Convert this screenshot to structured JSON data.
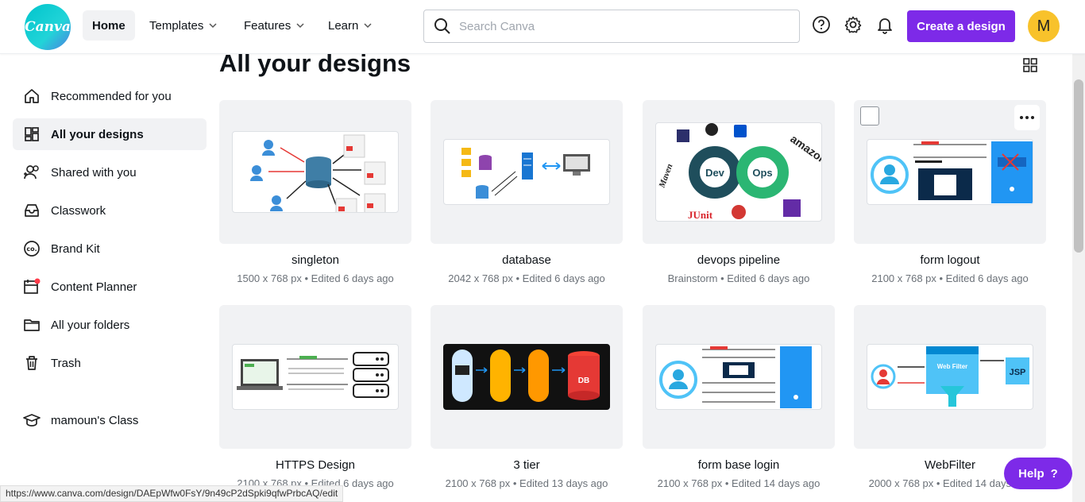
{
  "brand": {
    "logo_text": "Canva",
    "accent": "#7d2ae8"
  },
  "topnav": {
    "home": "Home",
    "templates": "Templates",
    "features": "Features",
    "learn": "Learn",
    "search_placeholder": "Search Canva",
    "create_label": "Create a design",
    "avatar_initial": "M"
  },
  "sidebar": {
    "items": [
      {
        "label": "Recommended for you",
        "icon": "home-icon"
      },
      {
        "label": "All your designs",
        "icon": "grid-icon"
      },
      {
        "label": "Shared with you",
        "icon": "people-icon"
      },
      {
        "label": "Classwork",
        "icon": "inbox-icon"
      },
      {
        "label": "Brand Kit",
        "icon": "brand-kit-icon"
      },
      {
        "label": "Content Planner",
        "icon": "calendar-icon"
      },
      {
        "label": "All your folders",
        "icon": "folder-icon"
      },
      {
        "label": "Trash",
        "icon": "trash-icon"
      },
      {
        "label": "mamoun's Class",
        "icon": "graduation-cap-icon"
      }
    ]
  },
  "main": {
    "title": "All your designs",
    "designs": [
      {
        "title": "singleton",
        "meta": "1500 x 768 px • Edited 6 days ago"
      },
      {
        "title": "database",
        "meta": "2042 x 768 px • Edited 6 days ago"
      },
      {
        "title": "devops pipeline",
        "meta": "Brainstorm • Edited 6 days ago"
      },
      {
        "title": "form logout",
        "meta": "2100 x 768 px • Edited 6 days ago"
      },
      {
        "title": "HTTPS Design",
        "meta": "2100 x 768 px • Edited 6 days ago"
      },
      {
        "title": "3 tier",
        "meta": "2100 x 768 px • Edited 13 days ago"
      },
      {
        "title": "form base login",
        "meta": "2100 x 768 px • Edited 14 days ago"
      },
      {
        "title": "WebFilter",
        "meta": "2000 x 768 px • Edited 14 days ago"
      }
    ],
    "thumb_text": {
      "devops_dev": "Dev",
      "devops_ops": "Ops",
      "amazon": "amazon",
      "maven": "Maven",
      "junit": "JUnit",
      "tier_db": "DB",
      "webfilter_title": "Web Filter",
      "webfilter_jsp": "JSP"
    }
  },
  "help": {
    "label": "Help",
    "glyph": "?"
  },
  "status_url": "https://www.canva.com/design/DAEpWfw0FsY/9n49cP2dSpki9qfwPrbcAQ/edit"
}
